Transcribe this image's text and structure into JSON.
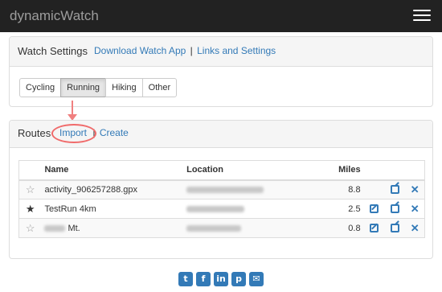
{
  "navbar": {
    "brand": "dynamicWatch"
  },
  "watch_settings": {
    "title": "Watch Settings",
    "download_link": "Download Watch App",
    "separator": "|",
    "links_link": "Links and Settings",
    "activity_tabs": [
      {
        "label": "Cycling",
        "active": false
      },
      {
        "label": "Running",
        "active": true
      },
      {
        "label": "Hiking",
        "active": false
      },
      {
        "label": "Other",
        "active": false
      }
    ]
  },
  "routes": {
    "title": "Routes",
    "import_link": "Import",
    "separator": "|",
    "create_link": "Create",
    "columns": {
      "name": "Name",
      "location": "Location",
      "miles": "Miles"
    },
    "rows": [
      {
        "starred": false,
        "star_icon": "star-empty-icon",
        "name": "activity_906257288.gpx",
        "location_redacted": true,
        "miles": "8.8",
        "has_edit": false
      },
      {
        "starred": true,
        "star_icon": "star-filled-icon",
        "name": "TestRun 4km",
        "location_redacted": true,
        "miles": "2.5",
        "has_edit": true
      },
      {
        "starred": false,
        "star_icon": "star-empty-icon",
        "name": "Mt.",
        "name_prefix_redacted": true,
        "location_redacted": true,
        "miles": "0.8",
        "has_edit": true
      }
    ]
  },
  "social": [
    "twitter-icon",
    "facebook-icon",
    "linkedin-icon",
    "pinterest-icon",
    "email-icon"
  ],
  "colors": {
    "navbar": "#222222",
    "link": "#337ab7",
    "annotation": "#f06a6a"
  }
}
